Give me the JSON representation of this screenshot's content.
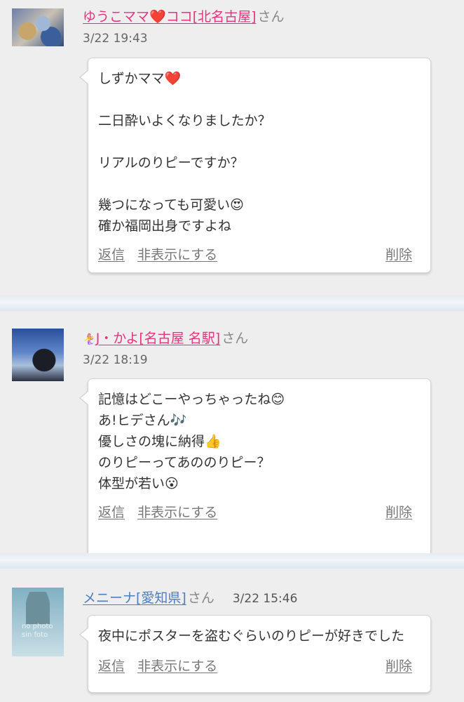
{
  "comments": [
    {
      "user": {
        "prefix": "",
        "name_pink": "ゆうこママ",
        "heart": "❤️",
        "name_rest": "ココ[北名古屋]",
        "suffix": "さん"
      },
      "time": "3/22 19:43",
      "message": "しずかママ❤️\n\n二日酔いよくなりましたか？\n\nリアルのりピーですか？\n\n幾つになっても可愛い😍\n確か福岡出身ですよね",
      "actions": {
        "reply": "返信",
        "hide": "非表示にする",
        "delete": "削除"
      }
    },
    {
      "user": {
        "prefix": "🧜‍♀️",
        "name_pink": "J・かよ[名古屋 名駅]",
        "suffix": "さん"
      },
      "time": "3/22 18:19",
      "message": "記憶はどこーやっちゃったね😊\nあ!ヒデさん🎶\n優しさの塊に納得👍\nのりピーってあののりピー？\n体型が若い😮",
      "actions": {
        "reply": "返信",
        "hide": "非表示にする",
        "delete": "削除"
      }
    },
    {
      "user": {
        "name_blue": "メニーナ[愛知県]",
        "suffix": "さん"
      },
      "time": "3/22 15:46",
      "avatar_text": "no photo\nsin foto",
      "message": "夜中にポスターを盗むぐらいのりピーが好きでした",
      "actions": {
        "reply": "返信",
        "hide": "非表示にする",
        "delete": "削除"
      }
    }
  ]
}
